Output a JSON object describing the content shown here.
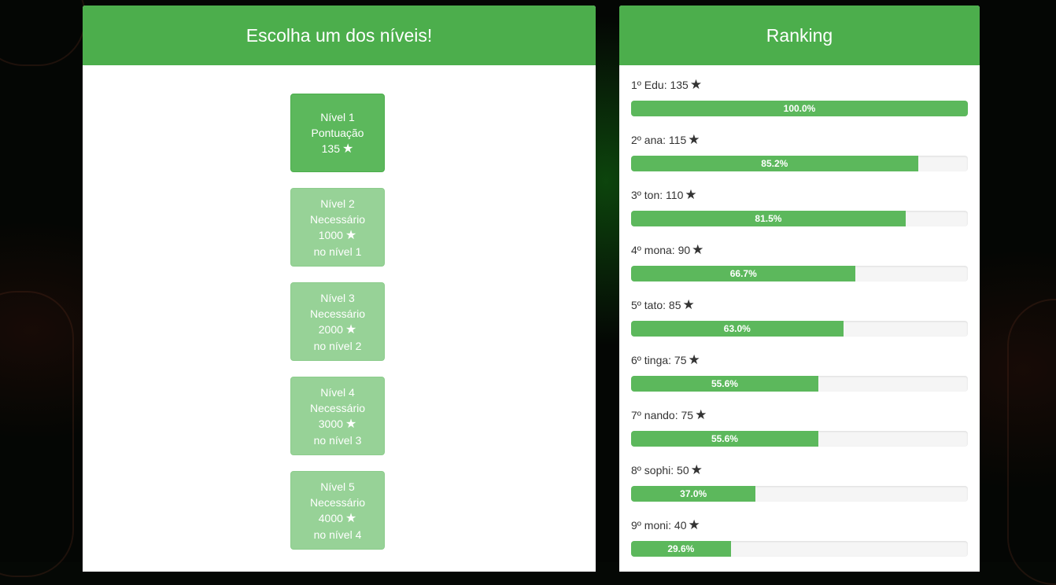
{
  "levels_panel": {
    "title": "Escolha um dos níveis!",
    "levels": [
      {
        "state": "unlocked",
        "lines": [
          "Nível 1",
          "Pontuação",
          "135"
        ]
      },
      {
        "state": "locked",
        "lines": [
          "Nível 2",
          "Necessário",
          "1000",
          "no nível 1"
        ]
      },
      {
        "state": "locked",
        "lines": [
          "Nível 3",
          "Necessário",
          "2000",
          "no nível 2"
        ]
      },
      {
        "state": "locked",
        "lines": [
          "Nível 4",
          "Necessário",
          "3000",
          "no nível 3"
        ]
      },
      {
        "state": "locked",
        "lines": [
          "Nível 5",
          "Necessário",
          "4000",
          "no nível 4"
        ]
      }
    ]
  },
  "ranking_panel": {
    "title": "Ranking",
    "entries": [
      {
        "label": "1º Edu: 135",
        "percent": 100.0,
        "percent_label": "100.0%"
      },
      {
        "label": "2º ana: 115",
        "percent": 85.2,
        "percent_label": "85.2%"
      },
      {
        "label": "3º ton: 110",
        "percent": 81.5,
        "percent_label": "81.5%"
      },
      {
        "label": "4º mona: 90",
        "percent": 66.7,
        "percent_label": "66.7%"
      },
      {
        "label": "5º tato: 85",
        "percent": 63.0,
        "percent_label": "63.0%"
      },
      {
        "label": "6º tinga: 75",
        "percent": 55.6,
        "percent_label": "55.6%"
      },
      {
        "label": "7º nando: 75",
        "percent": 55.6,
        "percent_label": "55.6%"
      },
      {
        "label": "8º sophi: 50",
        "percent": 37.0,
        "percent_label": "37.0%"
      },
      {
        "label": "9º moni: 40",
        "percent": 29.6,
        "percent_label": "29.6%"
      }
    ]
  },
  "icons": {
    "star": "★"
  },
  "colors": {
    "primary_green": "#5cb85c",
    "header_green": "#4cae4c",
    "locked_green": "#97d297",
    "track": "#f5f5f5"
  }
}
